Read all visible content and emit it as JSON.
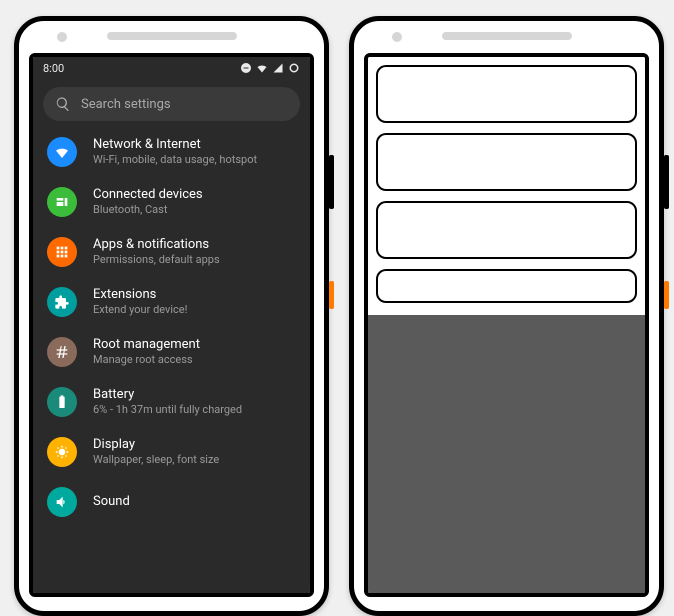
{
  "statusbar": {
    "time": "8:00"
  },
  "search": {
    "placeholder": "Search settings"
  },
  "settings": [
    {
      "key": "network",
      "title": "Network & Internet",
      "sub": "Wi-Fi, mobile, data usage, hotspot",
      "color": "c-blue",
      "icon": "wifi"
    },
    {
      "key": "devices",
      "title": "Connected devices",
      "sub": "Bluetooth, Cast",
      "color": "c-green",
      "icon": "devices"
    },
    {
      "key": "apps",
      "title": "Apps & notifications",
      "sub": "Permissions, default apps",
      "color": "c-orange",
      "icon": "apps"
    },
    {
      "key": "extensions",
      "title": "Extensions",
      "sub": "Extend your device!",
      "color": "c-teal",
      "icon": "puzzle"
    },
    {
      "key": "root",
      "title": "Root management",
      "sub": "Manage root access",
      "color": "c-brown",
      "icon": "hash"
    },
    {
      "key": "battery",
      "title": "Battery",
      "sub": "6% - 1h 37m until fully charged",
      "color": "c-dteal",
      "icon": "battery"
    },
    {
      "key": "display",
      "title": "Display",
      "sub": "Wallpaper, sleep, font size",
      "color": "c-yorange",
      "icon": "brightness"
    },
    {
      "key": "sound",
      "title": "Sound",
      "sub": "",
      "color": "c-teal2",
      "icon": "volume"
    }
  ],
  "wireframe": {
    "cards": [
      {
        "kind": "tall"
      },
      {
        "kind": "tall"
      },
      {
        "kind": "tall"
      },
      {
        "kind": "short"
      }
    ]
  }
}
